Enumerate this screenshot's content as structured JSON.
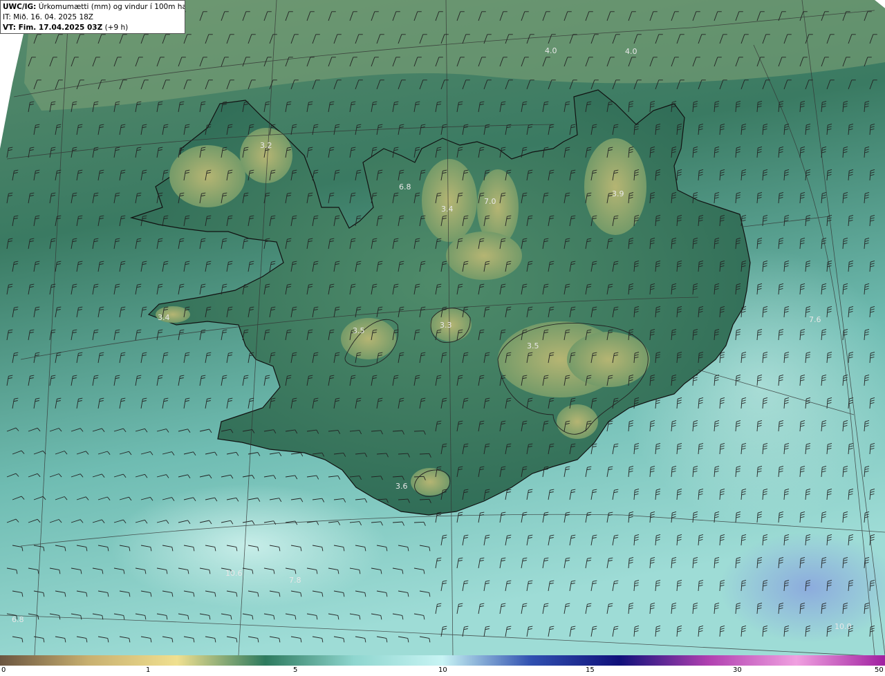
{
  "header": {
    "line1_bold": "UWC/IG:",
    "line1_text": "Úrkomumætti (mm) og vindur í 100m hæð",
    "line2": "IT: Mið. 16. 04. 2025 18Z",
    "line3_bold": "VT: Fim. 17.04.2025 03Z",
    "line3_text": "(+9 h)"
  },
  "value_labels": [
    "4.0",
    "4.0",
    "3.2",
    "6.8",
    "3.4",
    "7.0",
    "3.9",
    "3.4",
    "3.5",
    "3.3",
    "3.5",
    "7.6",
    "3.6",
    "10.6",
    "7.8",
    "6.8",
    "10.0"
  ],
  "colorbar": {
    "ticks": [
      "0",
      "1",
      "5",
      "10",
      "15",
      "30",
      "50"
    ],
    "colors": [
      "#6b5540",
      "#c8b070",
      "#f0e090",
      "#2d7a5e",
      "#8fd6cf",
      "#c8f4f4",
      "#3050b0",
      "#10107a",
      "#b040b0",
      "#f0a0e0",
      "#a020a0"
    ]
  },
  "colors": {
    "land_dark": "#2f6d56",
    "land_light": "#a9b06e",
    "sea_north": "#5e9474",
    "sea_south": "#8fd3cc",
    "coastline": "#111111"
  }
}
